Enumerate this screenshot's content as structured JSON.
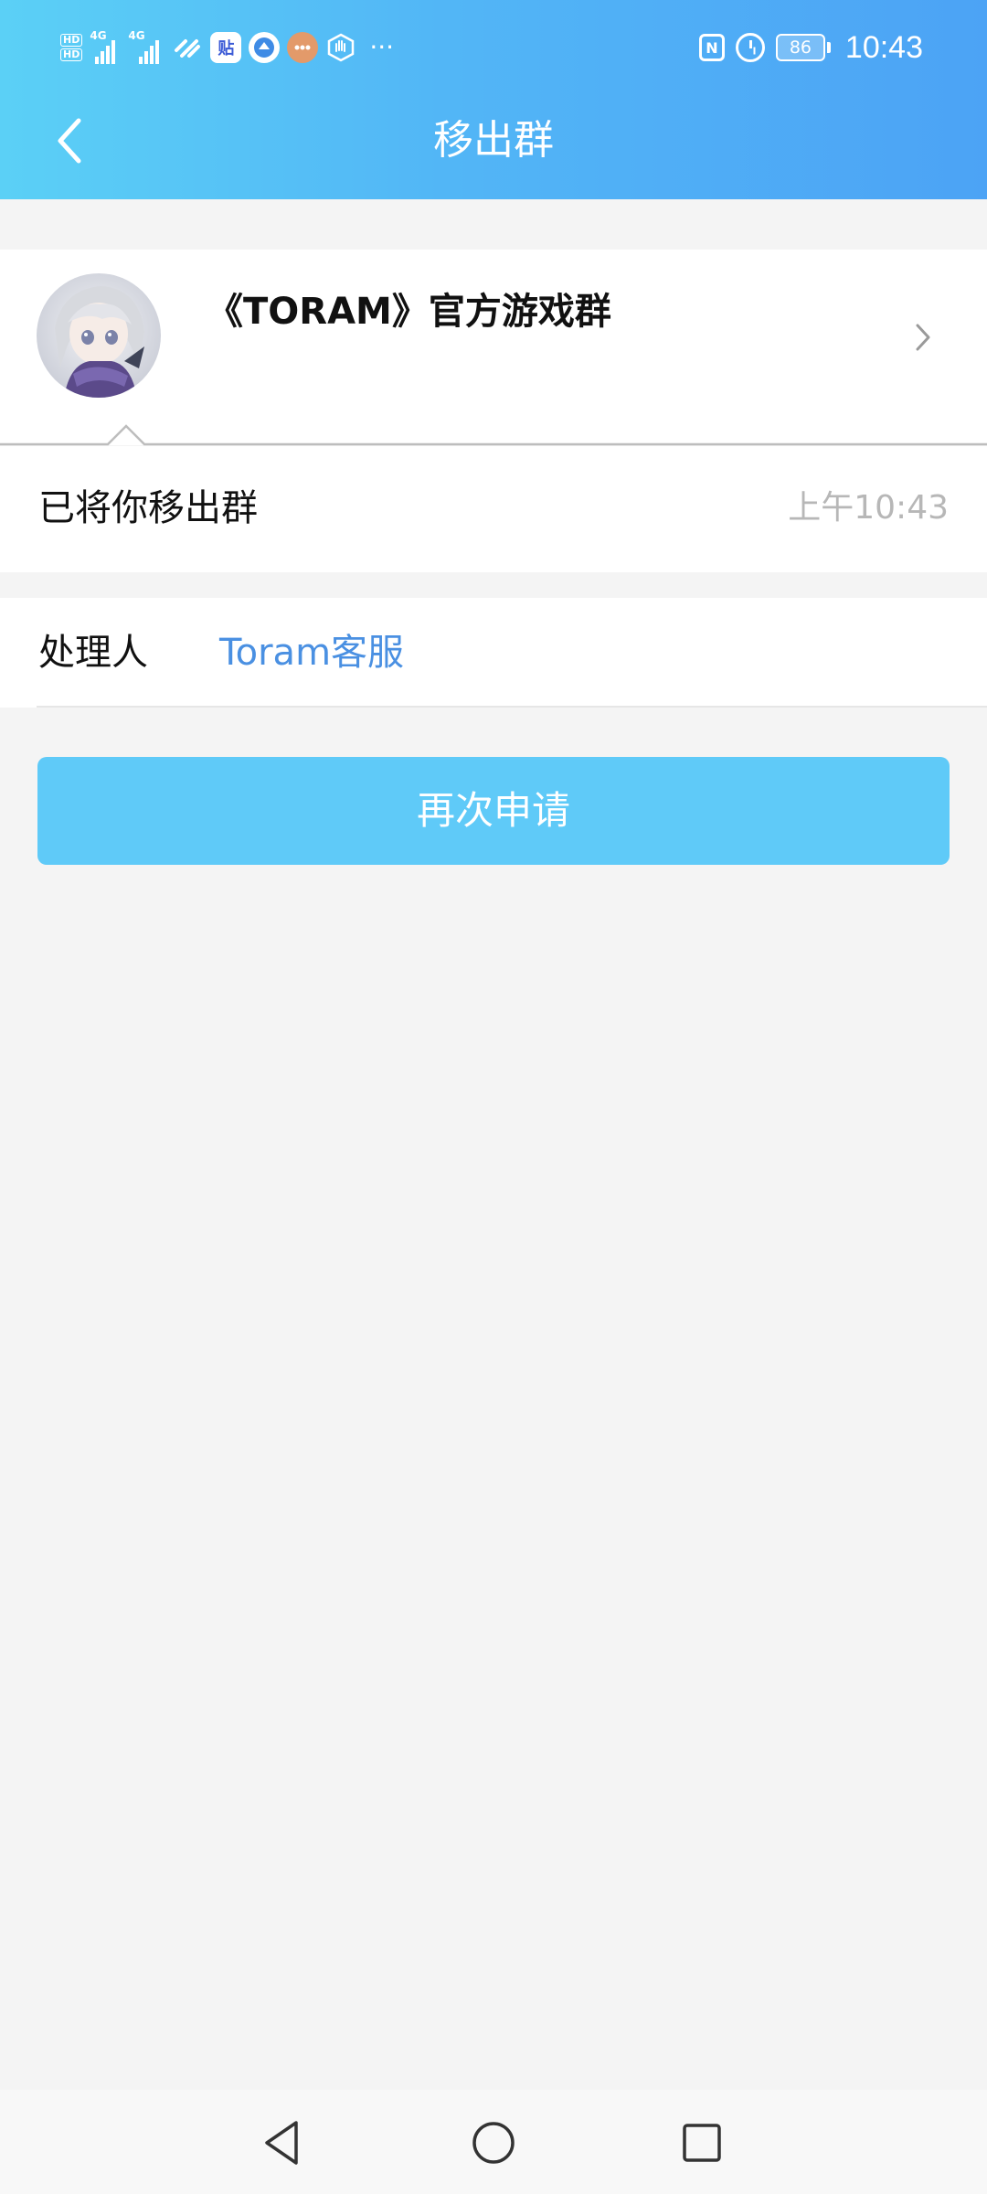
{
  "status_bar": {
    "hd_labels": [
      "HD",
      "HD"
    ],
    "network_1": "4G",
    "network_2": "4G",
    "app_icons": [
      "tieba-icon",
      "browser-icon",
      "chat-bubble-icon",
      "hand-icon"
    ],
    "app_icon_text": {
      "tieba": "贴"
    },
    "more": "···",
    "nfc": "N",
    "battery_level": "86",
    "time": "10:43"
  },
  "header": {
    "title": "移出群"
  },
  "group": {
    "name": "《TORAM》官方游戏群"
  },
  "message": {
    "text": "已将你移出群",
    "time": "上午10:43"
  },
  "handler": {
    "label": "处理人",
    "name": "Toram客服"
  },
  "actions": {
    "reapply_label": "再次申请"
  },
  "colors": {
    "header_gradient_start": "#5bd0f6",
    "header_gradient_end": "#4ca3f5",
    "button": "#5fcaf8",
    "link": "#4a90e2",
    "timestamp": "#b7b7b7",
    "background": "#f4f4f4"
  }
}
